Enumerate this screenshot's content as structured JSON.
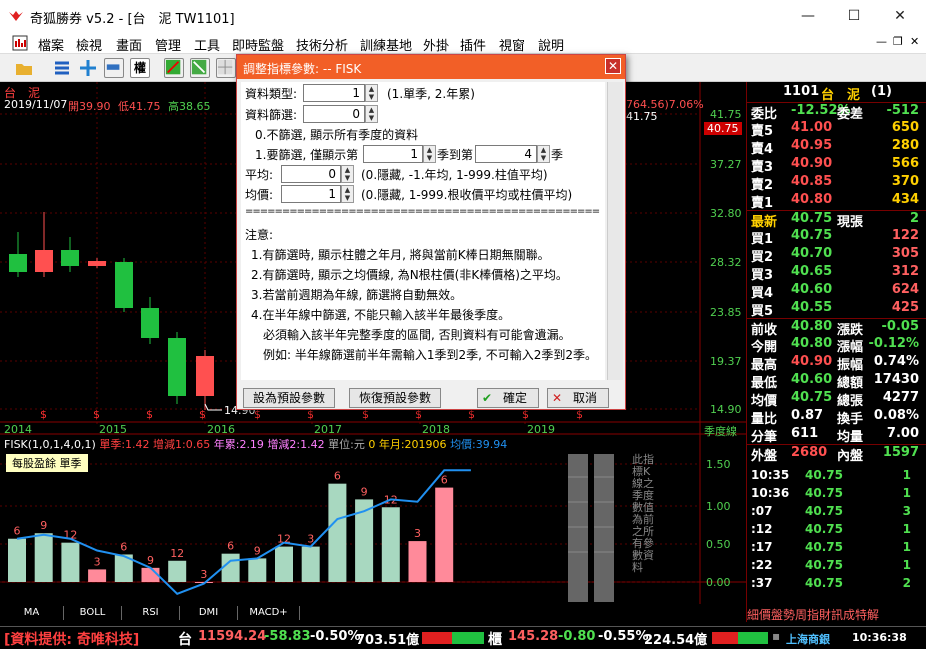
{
  "window": {
    "title": "奇狐勝券 v5.2 - [台　泥 TW1101]",
    "minimize": "—",
    "maximize": "☐",
    "close": "✕"
  },
  "menu": [
    "檔案",
    "檢視",
    "畫面",
    "管理",
    "工具",
    "即時監盤",
    "技術分析",
    "訓練基地",
    "外掛",
    "插件",
    "視窗",
    "說明"
  ],
  "menu_right": {
    "minimize": "—",
    "restore": "❐",
    "close": "✕"
  },
  "chart_header": {
    "stock": "台　泥",
    "date": "2019/11/07",
    "open": "開39.90",
    "low": "低41.75",
    "high": "高38.65",
    "right_info": "764.56)7.06%",
    "right_price": "41.75"
  },
  "price_axis": [
    "41.75",
    "40.75",
    "37.27",
    "32.80",
    "28.32",
    "23.85",
    "19.37",
    "14.90"
  ],
  "low_label": "14.90",
  "years": [
    "2014",
    "2015",
    "2016",
    "2017",
    "2018",
    "2019"
  ],
  "season_label": "季度線",
  "fisk_legend": {
    "params": "FISK(1,0,1,4,0,1)",
    "single": "單季:1.42",
    "inc": "增減1:0.65",
    "year": "年累:2.19",
    "inc2": "增減2:1.42",
    "unit": "單位:元",
    "ym": "0 年月:201906",
    "avg": "均價:39.94"
  },
  "eps_label": "每股盈餘 單季",
  "side_note": "此指標K線之季度數值為前之所有參數資料",
  "lower_axis": [
    "1.50",
    "1.00",
    "0.50",
    "0.00"
  ],
  "tabs": [
    "MA",
    "BOLL",
    "RSI",
    "DMI",
    "MACD+"
  ],
  "chart_data": {
    "type": "bar",
    "title": "每股盈餘 單季",
    "labels": [
      "6",
      "9",
      "12",
      "3",
      "6",
      "9",
      "12",
      "3",
      "6",
      "9",
      "12",
      "3",
      "6",
      "9",
      "12",
      "3",
      "6"
    ],
    "values": [
      0.55,
      0.62,
      0.5,
      0.16,
      0.35,
      0.18,
      0.27,
      0.0,
      0.36,
      0.3,
      0.45,
      0.45,
      1.25,
      1.05,
      0.95,
      0.52,
      1.2
    ],
    "line": [
      0.55,
      0.6,
      0.55,
      0.4,
      0.33,
      0.18,
      -0.15,
      -0.02,
      0.27,
      0.3,
      0.5,
      0.45,
      0.8,
      0.9,
      1.05,
      1.02,
      1.42,
      1.42
    ],
    "ylim": [
      0,
      1.5
    ]
  },
  "quote": {
    "header": {
      "code": "1101",
      "name": "台　泥",
      "num": "(1)"
    },
    "rows": [
      {
        "l": "委比",
        "v": "-12.52%",
        "r": "委差",
        "rv": "-512"
      },
      {
        "l": "賣5",
        "v": "41.00",
        "rv": "650"
      },
      {
        "l": "賣4",
        "v": "40.95",
        "rv": "280"
      },
      {
        "l": "賣3",
        "v": "40.90",
        "rv": "566"
      },
      {
        "l": "賣2",
        "v": "40.85",
        "rv": "370"
      },
      {
        "l": "賣1",
        "v": "40.80",
        "rv": "434"
      },
      {
        "l": "最新",
        "v": "40.75",
        "r": "現張",
        "rv": "2"
      },
      {
        "l": "買1",
        "v": "40.75",
        "rv": "122"
      },
      {
        "l": "買2",
        "v": "40.70",
        "rv": "305"
      },
      {
        "l": "買3",
        "v": "40.65",
        "rv": "312"
      },
      {
        "l": "買4",
        "v": "40.60",
        "rv": "624"
      },
      {
        "l": "買5",
        "v": "40.55",
        "rv": "425"
      },
      {
        "l": "前收",
        "v": "40.80",
        "r": "漲跌",
        "rv": "-0.05"
      },
      {
        "l": "今開",
        "v": "40.80",
        "r": "漲幅",
        "rv": "-0.12%"
      },
      {
        "l": "最高",
        "v": "40.90",
        "r": "振幅",
        "rv": "0.74%"
      },
      {
        "l": "最低",
        "v": "40.60",
        "r": "總額",
        "rv": "17430"
      },
      {
        "l": "均價",
        "v": "40.75",
        "r": "總張",
        "rv": "4277"
      },
      {
        "l": "量比",
        "v": "0.87",
        "r": "換手",
        "rv": "0.08%"
      },
      {
        "l": "分筆",
        "v": "611",
        "r": "均量",
        "rv": "7.00"
      },
      {
        "l": "外盤",
        "v": "2680",
        "r": "內盤",
        "rv": "1597"
      }
    ],
    "ticks": [
      {
        "t": "10:35",
        "p": "40.75",
        "v": "1"
      },
      {
        "t": "10:36",
        "p": "40.75",
        "v": "1"
      },
      {
        "t": ":07",
        "p": "40.75",
        "v": "3"
      },
      {
        "t": ":12",
        "p": "40.75",
        "v": "1"
      },
      {
        "t": ":17",
        "p": "40.75",
        "v": "1"
      },
      {
        "t": ":22",
        "p": "40.75",
        "v": "1"
      },
      {
        "t": ":37",
        "p": "40.75",
        "v": "2"
      }
    ],
    "tabs": "細價盤勢周指財訊成特解"
  },
  "status": {
    "provider": "[資料提供: 奇唯科技]",
    "tw": "台",
    "tw_idx": "11594.24",
    "tw_chg": "-58.83",
    "tw_pct": "-0.50%",
    "tw_amt": "703.51億",
    "otc": "櫃",
    "otc_idx": "145.28",
    "otc_chg": "-0.80",
    "otc_pct": "-0.55%",
    "otc_amt": "224.54億",
    "broker": "上海商銀",
    "time": "10:36:38"
  },
  "dialog": {
    "title": "調整指標參數: -- FISK",
    "data_type_label": "資料類型:",
    "data_type_val": "1",
    "data_type_hint": "(1.單季, 2.年累)",
    "filter_label": "資料篩選:",
    "filter_val": "0",
    "opt0": "0.不篩選, 顯示所有季度的資料",
    "opt1_a": "1.要篩選, 僅顯示第",
    "opt1_from": "1",
    "opt1_b": "季到第",
    "opt1_to": "4",
    "opt1_c": "季",
    "avg_label": "平均:",
    "avg_val": "0",
    "avg_hint": "(0.隱藏, -1.年均, 1-999.柱值平均)",
    "price_label": "均價:",
    "price_val": "1",
    "price_hint": "(0.隱藏, 1-999.根收價平均或柱價平均)",
    "sep": "================================================",
    "note_title": "注意:",
    "notes": [
      "1.有篩選時, 顯示柱體之年月, 將與當前K棒日期無關聯。",
      "2.有篩選時, 顯示之均價線, 為N根柱價(非K棒價格)之平均。",
      "3.若當前週期為年線, 篩選將自動無效。",
      "4.在半年線中篩選, 不能只輸入該半年最後季度。",
      "　必須輸入該半年完整季度的區間, 否則資料有可能會遺漏。",
      "　例如: 半年線篩選前半年需輸入1季到2季, 不可輸入2季到2季。"
    ],
    "btn_default": "設為預設參數",
    "btn_restore": "恢復預設參數",
    "btn_ok": "確定",
    "btn_cancel": "取消"
  }
}
